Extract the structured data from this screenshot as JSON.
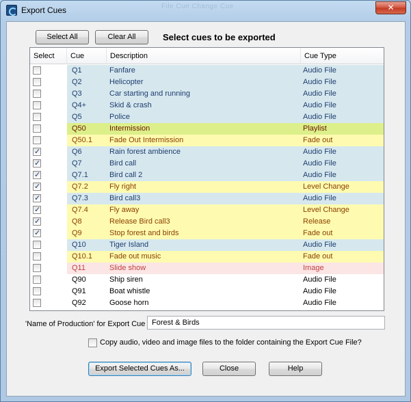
{
  "window": {
    "title": "Export Cues",
    "background_menu_ghost": "File Cue Change Cue"
  },
  "toolbar": {
    "select_all": "Select All",
    "clear_all": "Clear All",
    "heading": "Select cues to be exported"
  },
  "colors": {
    "audio_row_bg": "#d6e8ee",
    "audio_text": "#1f3d6f",
    "yellow_row_bg": "#fefbb0",
    "yellow_text": "#8b4000",
    "playlist_row_bg": "#dcef8a",
    "playlist_text": "#6b1700",
    "image_row_bg": "#fbe5e5",
    "image_text": "#c04040",
    "plain_row_bg": "#ffffff",
    "plain_text": "#000000"
  },
  "table": {
    "columns": [
      "Select",
      "Cue",
      "Description",
      "Cue Type"
    ],
    "rows": [
      {
        "checked": false,
        "cue": "Q1",
        "description": "Fanfare",
        "type": "Audio File",
        "style": "audio"
      },
      {
        "checked": false,
        "cue": "Q2",
        "description": "Helicopter",
        "type": "Audio File",
        "style": "audio"
      },
      {
        "checked": false,
        "cue": "Q3",
        "description": "Car starting and running",
        "type": "Audio File",
        "style": "audio"
      },
      {
        "checked": false,
        "cue": "Q4+",
        "description": "Skid & crash",
        "type": "Audio File",
        "style": "audio"
      },
      {
        "checked": false,
        "cue": "Q5",
        "description": "Police",
        "type": "Audio File",
        "style": "audio"
      },
      {
        "checked": false,
        "cue": "Q50",
        "description": "Intermission",
        "type": "Playlist",
        "style": "playlist"
      },
      {
        "checked": false,
        "cue": "Q50.1",
        "description": "Fade Out Intermission",
        "type": "Fade out",
        "style": "yellow"
      },
      {
        "checked": true,
        "cue": "Q6",
        "description": "Rain forest ambience",
        "type": "Audio File",
        "style": "audio"
      },
      {
        "checked": true,
        "cue": "Q7",
        "description": "Bird call",
        "type": "Audio File",
        "style": "audio"
      },
      {
        "checked": true,
        "cue": "Q7.1",
        "description": "Bird call 2",
        "type": "Audio File",
        "style": "audio"
      },
      {
        "checked": true,
        "cue": "Q7.2",
        "description": "Fly right",
        "type": "Level Change",
        "style": "yellow"
      },
      {
        "checked": true,
        "cue": "Q7.3",
        "description": "Bird call3",
        "type": "Audio File",
        "style": "audio"
      },
      {
        "checked": true,
        "cue": "Q7.4",
        "description": "Fly away",
        "type": "Level Change",
        "style": "yellow"
      },
      {
        "checked": true,
        "cue": "Q8",
        "description": "Release Bird call3",
        "type": "Release",
        "style": "yellow"
      },
      {
        "checked": true,
        "cue": "Q9",
        "description": "Stop forest and birds",
        "type": "Fade out",
        "style": "yellow"
      },
      {
        "checked": false,
        "cue": "Q10",
        "description": "Tiger Island",
        "type": "Audio File",
        "style": "audio"
      },
      {
        "checked": false,
        "cue": "Q10.1",
        "description": "Fade out music",
        "type": "Fade out",
        "style": "yellow"
      },
      {
        "checked": false,
        "cue": "Q11",
        "description": "Slide show",
        "type": "Image",
        "style": "image"
      },
      {
        "checked": false,
        "cue": "Q90",
        "description": "Ship siren",
        "type": "Audio File",
        "style": "plain"
      },
      {
        "checked": false,
        "cue": "Q91",
        "description": "Boat whistle",
        "type": "Audio File",
        "style": "plain"
      },
      {
        "checked": false,
        "cue": "Q92",
        "description": "Goose horn",
        "type": "Audio File",
        "style": "plain"
      }
    ]
  },
  "production": {
    "label": "'Name of Production' for Export Cue",
    "value": "Forest & Birds"
  },
  "copy_option": {
    "checked": false,
    "label": "Copy audio, video and image files to the folder containing the Export Cue File?"
  },
  "footer": {
    "export": "Export Selected Cues As...",
    "close": "Close",
    "help": "Help"
  }
}
